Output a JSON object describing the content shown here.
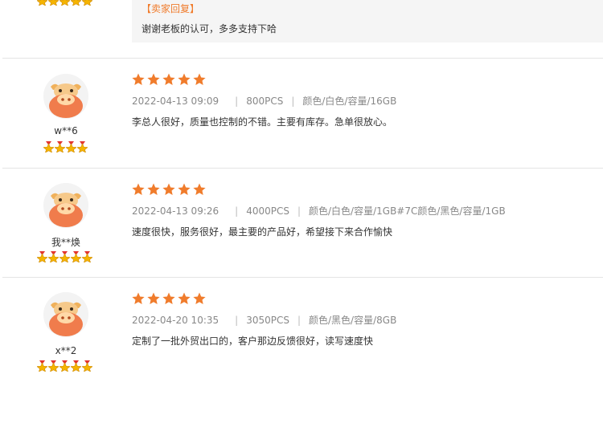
{
  "top_review": {
    "medal_count": 5,
    "reply_title": "【卖家回复】",
    "reply_text": "谢谢老板的认可，多多支持下哈"
  },
  "reviews": [
    {
      "username": "w**6",
      "medal_count": 4,
      "rating": 5,
      "date": "2022-04-13 09:09",
      "quantity": "800PCS",
      "spec": "颜色/白色/容量/16GB",
      "text": "李总人很好，质量也控制的不错。主要有库存。急单很放心。"
    },
    {
      "username": "我**焕",
      "medal_count": 5,
      "rating": 5,
      "date": "2022-04-13 09:26",
      "quantity": "4000PCS",
      "spec": "颜色/白色/容量/1GB#7C颜色/黑色/容量/1GB",
      "text": "速度很快，服务很好，最主要的产品好，希望接下来合作愉快"
    },
    {
      "username": "x**2",
      "medal_count": 5,
      "rating": 5,
      "date": "2022-04-20 10:35",
      "quantity": "3050PCS",
      "spec": "颜色/黑色/容量/8GB",
      "text": "定制了一批外贸出口的，客户那边反馈很好，读写速度快"
    }
  ],
  "colors": {
    "star": "#f07c2c",
    "reply_title": "#f07c2c",
    "medal_gold": "#f5b400",
    "medal_red": "#e3342f"
  },
  "icons": {
    "rating": "star-icon",
    "buyer_level": "medal-icon",
    "avatar": "cow-avatar-icon"
  }
}
